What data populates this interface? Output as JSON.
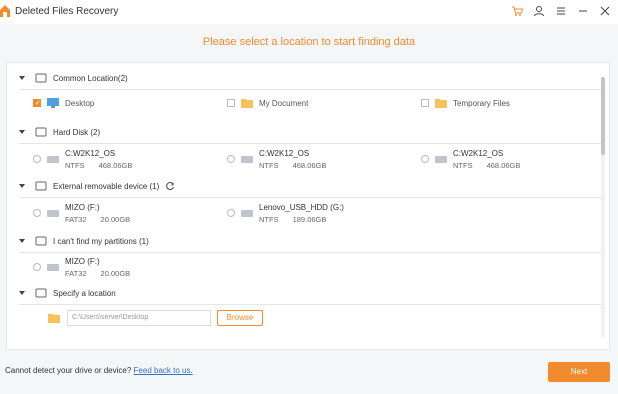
{
  "window": {
    "title": "Deleted Files Recovery"
  },
  "colors": {
    "accent": "#f28a2e",
    "link": "#2f72c6"
  },
  "heading": "Please select a location to start finding data",
  "sections": {
    "common": {
      "title": "Common Location(2)",
      "items": [
        {
          "label": "Desktop",
          "checked": true,
          "icon": "monitor-icon"
        },
        {
          "label": "My Document",
          "checked": false,
          "icon": "folder-icon"
        },
        {
          "label": "Temporary Files",
          "checked": false,
          "icon": "folder-icon"
        }
      ]
    },
    "hard_disk": {
      "title": "Hard Disk (2)",
      "drives": [
        {
          "name": "C:W2K12_OS",
          "fs": "NTFS",
          "size": "468.06GB"
        },
        {
          "name": "C:W2K12_OS",
          "fs": "NTFS",
          "size": "468.06GB"
        },
        {
          "name": "C:W2K12_OS",
          "fs": "NTFS",
          "size": "468.06GB"
        }
      ]
    },
    "external": {
      "title": "External removable device (1)",
      "drives": [
        {
          "name": "MIZO (F:)",
          "fs": "FAT32",
          "size": "20.00GB"
        },
        {
          "name": "Lenovo_USB_HDD (G:)",
          "fs": "NTFS",
          "size": "189.06GB"
        }
      ]
    },
    "cant_find": {
      "title": "I can't find my partitions (1)",
      "drives": [
        {
          "name": "MIZO (F:)",
          "fs": "FAT32",
          "size": "20.00GB"
        }
      ]
    },
    "specify": {
      "title": "Specify a location",
      "path_value": "C:\\Users\\server\\Desktop",
      "browse_label": "Browse"
    }
  },
  "footer": {
    "text": "Cannot detect your drive or device?",
    "link": "Feed back to us.",
    "next_label": "Next"
  }
}
